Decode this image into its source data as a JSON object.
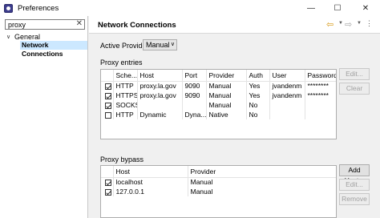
{
  "window": {
    "title": "Preferences"
  },
  "sidebar": {
    "search": {
      "value": "proxy",
      "clear_glyph": "✕"
    },
    "tree": {
      "general_label": "General",
      "network_label": "Network Connections"
    }
  },
  "header": {
    "title": "Network Connections"
  },
  "provider": {
    "label": "Active Provider:",
    "selected": "Manual"
  },
  "proxy_entries": {
    "label": "Proxy entries",
    "columns": [
      "",
      "Sche...",
      "Host",
      "Port",
      "Provider",
      "Auth",
      "User",
      "Password"
    ],
    "rows": [
      {
        "checked": true,
        "scheme": "HTTP",
        "host": "proxy.la.gov",
        "port": "9090",
        "provider": "Manual",
        "auth": "Yes",
        "user": "jvandenm",
        "password": "********"
      },
      {
        "checked": true,
        "scheme": "HTTPS",
        "host": "proxy.la.gov",
        "port": "9090",
        "provider": "Manual",
        "auth": "Yes",
        "user": "jvandenm",
        "password": "********"
      },
      {
        "checked": true,
        "scheme": "SOCKS",
        "host": "",
        "port": "",
        "provider": "Manual",
        "auth": "No",
        "user": "",
        "password": ""
      },
      {
        "checked": false,
        "scheme": "HTTP",
        "host": "Dynamic",
        "port": "Dyna...",
        "provider": "Native",
        "auth": "No",
        "user": "",
        "password": ""
      }
    ],
    "buttons": {
      "edit": "Edit...",
      "clear": "Clear"
    }
  },
  "proxy_bypass": {
    "label": "Proxy bypass",
    "columns": [
      "",
      "Host",
      "Provider"
    ],
    "rows": [
      {
        "checked": true,
        "host": "localhost",
        "provider": "Manual"
      },
      {
        "checked": true,
        "host": "127.0.0.1",
        "provider": "Manual"
      }
    ],
    "buttons": {
      "add_host": "Add Host...",
      "edit": "Edit...",
      "remove": "Remove"
    }
  },
  "colors": {
    "selection": "#cce8ff",
    "back_arrow": "#d89a1a"
  },
  "icons": {
    "app": "eclipse-icon",
    "back": "back-arrow-icon",
    "forward": "forward-arrow-icon",
    "menu": "view-menu-icon"
  }
}
